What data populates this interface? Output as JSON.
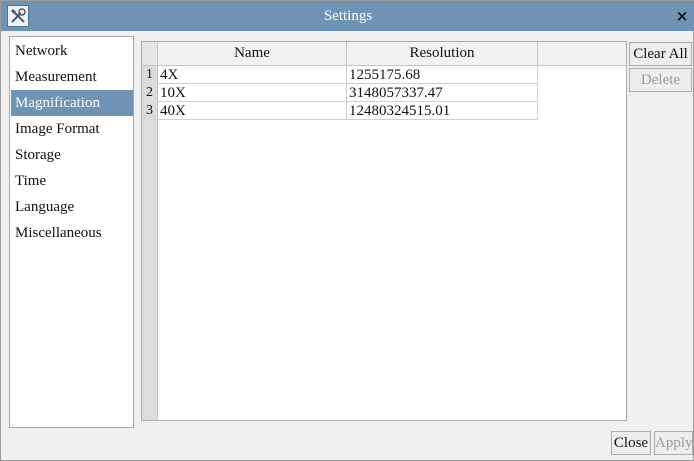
{
  "window": {
    "title": "Settings",
    "icon": "tools-icon",
    "close_label": "×"
  },
  "sidebar": {
    "items": [
      {
        "label": "Network"
      },
      {
        "label": "Measurement"
      },
      {
        "label": "Magnification",
        "selected": true
      },
      {
        "label": "Image Format"
      },
      {
        "label": "Storage"
      },
      {
        "label": "Time"
      },
      {
        "label": "Language"
      },
      {
        "label": "Miscellaneous"
      }
    ]
  },
  "table": {
    "columns": [
      "Name",
      "Resolution"
    ],
    "rows": [
      {
        "index": "1",
        "name": "4X",
        "resolution": "1255175.68"
      },
      {
        "index": "2",
        "name": "10X",
        "resolution": "3148057337.47"
      },
      {
        "index": "3",
        "name": "40X",
        "resolution": "12480324515.01"
      }
    ]
  },
  "side_buttons": {
    "clear_all": "Clear All",
    "delete": "Delete"
  },
  "footer": {
    "close": "Close",
    "apply": "Apply"
  },
  "colors": {
    "accent": "#6f93b4",
    "window_bg": "#f0f0f0",
    "disabled_text": "#9a9a9a"
  }
}
